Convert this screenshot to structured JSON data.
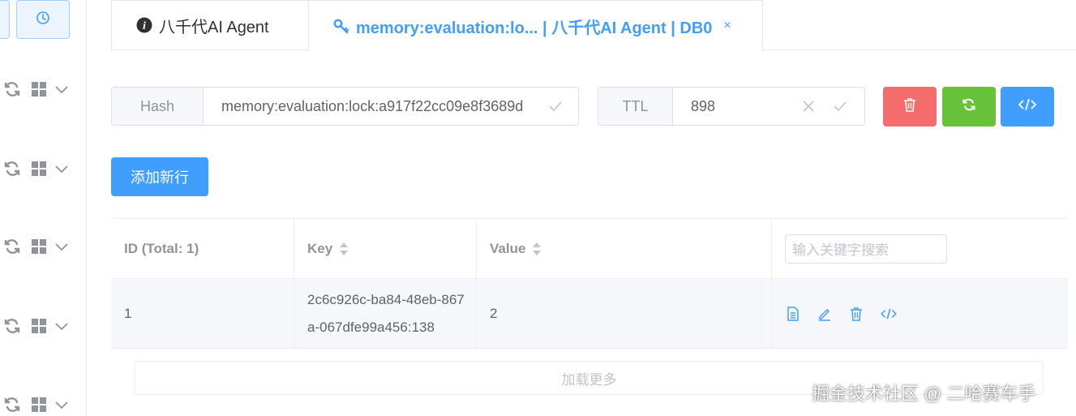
{
  "colors": {
    "primary": "#409eff",
    "danger": "#f56c6c",
    "success": "#67c23a",
    "border": "#dcdfe6",
    "muted_text": "#909399"
  },
  "sidebar": {
    "history_icon": "clock-icon",
    "row_icons": [
      "refresh-icon",
      "grid-icon",
      "chevron-down-icon"
    ]
  },
  "tabs": [
    {
      "label": "八千代AI Agent",
      "icon": "info-icon"
    },
    {
      "label": "memory:evaluation:lo... | 八千代AI Agent | DB0",
      "icon": "key-icon",
      "close": "×"
    }
  ],
  "hash": {
    "label": "Hash",
    "value": "memory:evaluation:lock:a917f22cc09e8f3689d"
  },
  "ttl": {
    "label": "TTL",
    "value": "898"
  },
  "toolbar": {
    "delete_icon": "trash-icon",
    "refresh_icon": "refresh-icon",
    "code_icon": "code-icon"
  },
  "add_row_label": "添加新行",
  "table": {
    "columns": [
      "ID (Total: 1)",
      "Key",
      "Value"
    ],
    "search_placeholder": "输入关键字搜索",
    "rows": [
      {
        "id": "1",
        "key": "2c6c926c-ba84-48eb-867a-067dfe99a456:138",
        "value": "2"
      }
    ],
    "row_action_icons": [
      "document-icon",
      "edit-icon",
      "trash-icon",
      "code-icon"
    ]
  },
  "load_more_label": "加载更多",
  "watermark": "掘金技术社区 @ 二哈赛车手"
}
